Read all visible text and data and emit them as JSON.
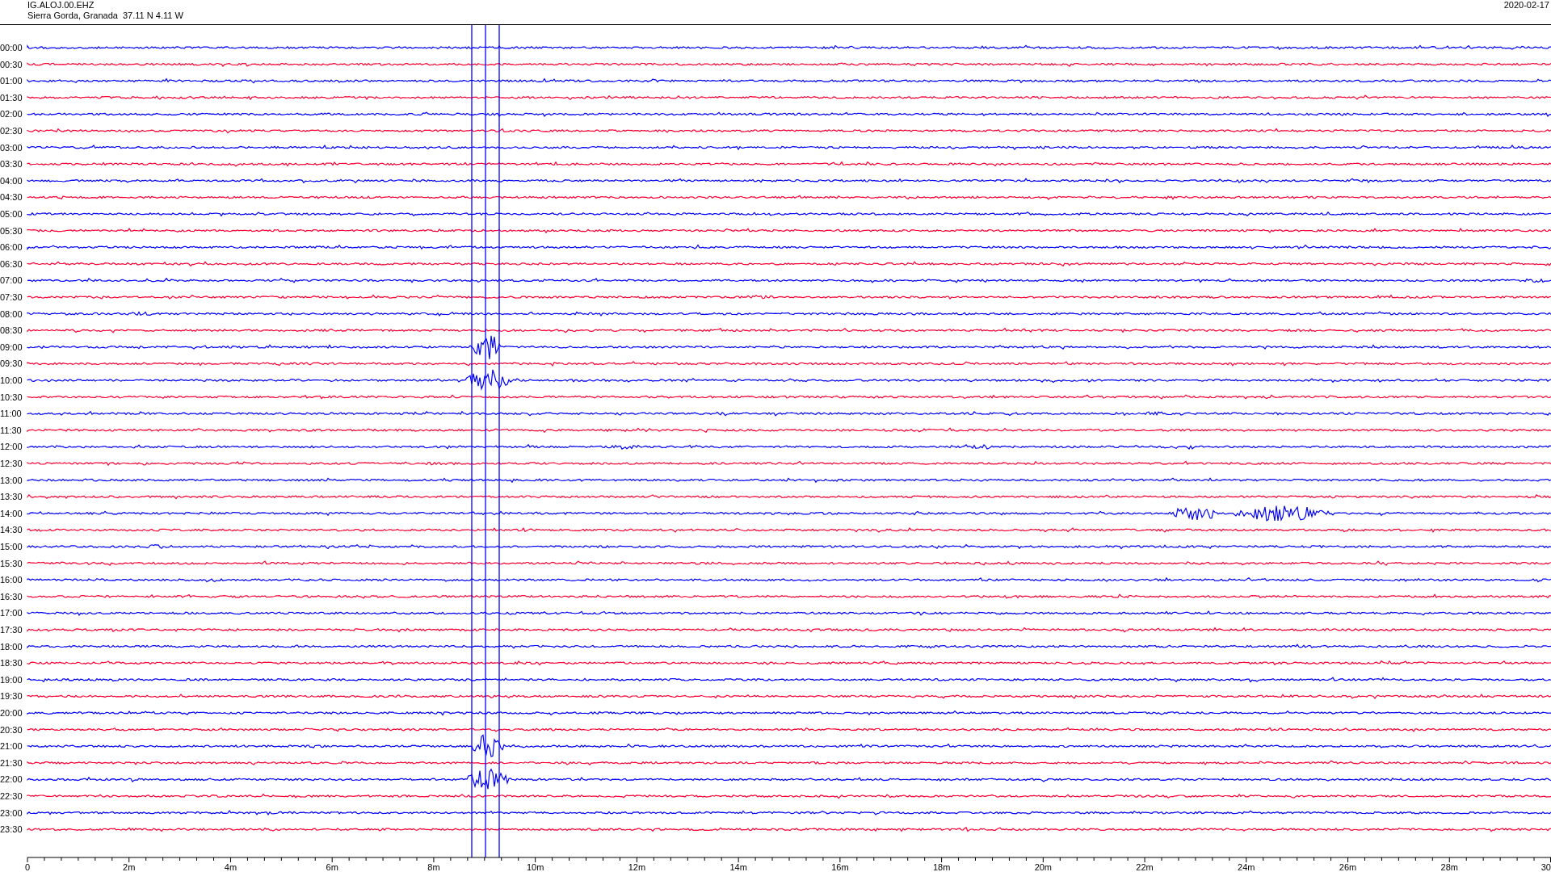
{
  "header": {
    "station": "IG.ALOJ.00.EHZ",
    "location": "Sierra Gorda, Granada  37.11 N 4.11 W",
    "date": "2020-02-17"
  },
  "rows": [
    {
      "label": "00:00",
      "color": "#0000ff"
    },
    {
      "label": "00:30",
      "color": "#ff0033"
    },
    {
      "label": "01:00",
      "color": "#0000ff"
    },
    {
      "label": "01:30",
      "color": "#ff0033"
    },
    {
      "label": "02:00",
      "color": "#0000ff"
    },
    {
      "label": "02:30",
      "color": "#ff0033"
    },
    {
      "label": "03:00",
      "color": "#0000ff"
    },
    {
      "label": "03:30",
      "color": "#ff0033"
    },
    {
      "label": "04:00",
      "color": "#0000ff"
    },
    {
      "label": "04:30",
      "color": "#ff0033"
    },
    {
      "label": "05:00",
      "color": "#0000ff"
    },
    {
      "label": "05:30",
      "color": "#ff0033"
    },
    {
      "label": "06:00",
      "color": "#0000ff"
    },
    {
      "label": "06:30",
      "color": "#ff0033"
    },
    {
      "label": "07:00",
      "color": "#0000ff"
    },
    {
      "label": "07:30",
      "color": "#ff0033"
    },
    {
      "label": "08:00",
      "color": "#0000ff"
    },
    {
      "label": "08:30",
      "color": "#ff0033"
    },
    {
      "label": "09:00",
      "color": "#0000ff"
    },
    {
      "label": "09:30",
      "color": "#ff0033"
    },
    {
      "label": "10:00",
      "color": "#0000ff"
    },
    {
      "label": "10:30",
      "color": "#ff0033"
    },
    {
      "label": "11:00",
      "color": "#0000ff"
    },
    {
      "label": "11:30",
      "color": "#ff0033"
    },
    {
      "label": "12:00",
      "color": "#0000ff"
    },
    {
      "label": "12:30",
      "color": "#ff0033"
    },
    {
      "label": "13:00",
      "color": "#0000ff"
    },
    {
      "label": "13:30",
      "color": "#ff0033"
    },
    {
      "label": "14:00",
      "color": "#0000ff"
    },
    {
      "label": "14:30",
      "color": "#ff0033"
    },
    {
      "label": "15:00",
      "color": "#0000ff"
    },
    {
      "label": "15:30",
      "color": "#ff0033"
    },
    {
      "label": "16:00",
      "color": "#0000ff"
    },
    {
      "label": "16:30",
      "color": "#ff0033"
    },
    {
      "label": "17:00",
      "color": "#0000ff"
    },
    {
      "label": "17:30",
      "color": "#ff0033"
    },
    {
      "label": "18:00",
      "color": "#0000ff"
    },
    {
      "label": "18:30",
      "color": "#ff0033"
    },
    {
      "label": "19:00",
      "color": "#0000ff"
    },
    {
      "label": "19:30",
      "color": "#ff0033"
    },
    {
      "label": "20:00",
      "color": "#0000ff"
    },
    {
      "label": "20:30",
      "color": "#ff0033"
    },
    {
      "label": "21:00",
      "color": "#0000ff"
    },
    {
      "label": "21:30",
      "color": "#ff0033"
    },
    {
      "label": "22:00",
      "color": "#0000ff"
    },
    {
      "label": "22:30",
      "color": "#ff0033"
    },
    {
      "label": "23:00",
      "color": "#0000ff"
    },
    {
      "label": "23:30",
      "color": "#ff0033"
    }
  ],
  "x_axis_labels": [
    "0",
    "2m",
    "4m",
    "6m",
    "8m",
    "10m",
    "12m",
    "14m",
    "16m",
    "18m",
    "20m",
    "22m",
    "24m",
    "26m",
    "28m",
    "30"
  ]
}
